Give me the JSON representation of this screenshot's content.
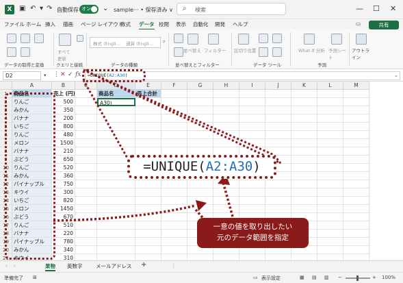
{
  "titlebar": {
    "autosave_label": "自動保存",
    "autosave_state": "オン",
    "doc_title": "sample··· • 保存済み ∨",
    "search_placeholder": "検索"
  },
  "menu": {
    "items": [
      "ファイル",
      "ホーム",
      "挿入",
      "描画",
      "ページ レイアウト",
      "数式",
      "データ",
      "校閲",
      "表示",
      "自動化",
      "開発",
      "ヘルプ"
    ],
    "active": "データ",
    "share_label": "共有"
  },
  "ribbon": {
    "btn_all_update": "すべて更新",
    "btn_stock": "株式 (Engli…",
    "btn_currency": "通貨 (Engli…",
    "btn_sort": "並べ替え",
    "btn_filter": "フィルター",
    "btn_text_split": "区切り位置",
    "btn_whatif": "What-If 分析",
    "btn_forecast": "予測シート",
    "btn_outline": "アウトライン",
    "group_get": "データの取得と変換",
    "group_query": "クエリと接続",
    "group_dtype": "データの種類",
    "group_sort": "並べ替えとフィルター",
    "group_tools": "データ ツール",
    "group_forecast": "予測"
  },
  "formula_bar": {
    "name_box": "D2",
    "fx": "fx",
    "formula_prefix": "=UNIQUE(",
    "formula_range": "A2:A30",
    "formula_suffix": ")"
  },
  "grid": {
    "columns": [
      "A",
      "B",
      "C",
      "D",
      "E",
      "F",
      "G",
      "H",
      "I",
      "J",
      "K",
      "L",
      "M"
    ],
    "row_numbers": [
      "1",
      "2",
      "3",
      "4",
      "5",
      "6",
      "7",
      "8",
      "9",
      "10",
      "11",
      "12",
      "13",
      "14",
      "15",
      "16",
      "17",
      "18",
      "19",
      "20",
      "21",
      "22"
    ],
    "col_a_header": "商品名",
    "col_b_header": "売上 (円)",
    "rows": [
      {
        "a": "りんご",
        "b": "500"
      },
      {
        "a": "みかん",
        "b": "350"
      },
      {
        "a": "バナナ",
        "b": "200"
      },
      {
        "a": "いちご",
        "b": "800"
      },
      {
        "a": "りんご",
        "b": "480"
      },
      {
        "a": "メロン",
        "b": "1500"
      },
      {
        "a": "バナナ",
        "b": "210"
      },
      {
        "a": "ぶどう",
        "b": "650"
      },
      {
        "a": "りんご",
        "b": "520"
      },
      {
        "a": "みかん",
        "b": "360"
      },
      {
        "a": "パイナップル",
        "b": "750"
      },
      {
        "a": "キウイ",
        "b": "300"
      },
      {
        "a": "いちご",
        "b": "820"
      },
      {
        "a": "メロン",
        "b": "1450"
      },
      {
        "a": "ぶどう",
        "b": "670"
      },
      {
        "a": "りんご",
        "b": "510"
      },
      {
        "a": "バナナ",
        "b": "220"
      },
      {
        "a": "パイナップル",
        "b": "780"
      },
      {
        "a": "みかん",
        "b": "340"
      },
      {
        "a": "キウイ",
        "b": "310"
      }
    ],
    "d1": "商品名",
    "e1": "売上合計",
    "d2": "A30)"
  },
  "overlay": {
    "big_formula_prefix": "=UNIQUE(",
    "big_formula_range": "A2:A30",
    "big_formula_suffix": ")",
    "callout_line1": "一意の値を取り出したい",
    "callout_line2": "元のデータ範囲を指定",
    "accent_color": "#8b1a1a"
  },
  "tabs": {
    "items": [
      "果物",
      "英数字",
      "メールアドレス"
    ],
    "active": "果物",
    "add": "+"
  },
  "status": {
    "ready": "準備完了",
    "display_settings": "表示設定",
    "zoom": "100%"
  }
}
